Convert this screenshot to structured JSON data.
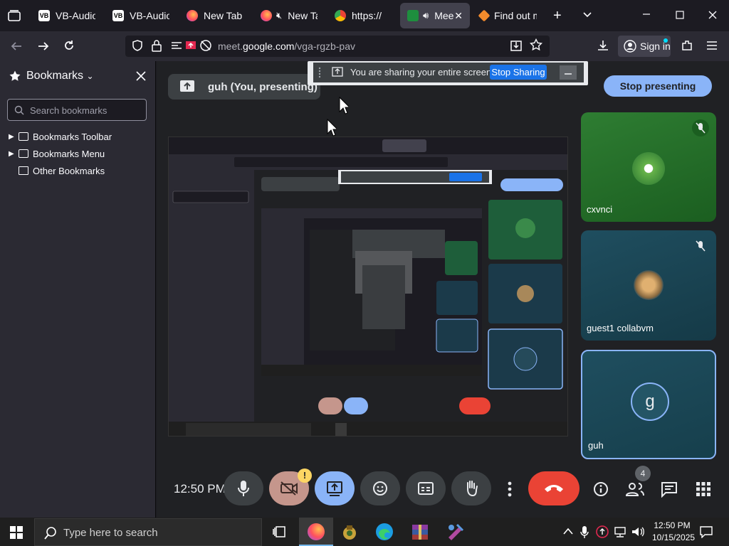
{
  "tabs": [
    {
      "title": "VB-Audio V",
      "icon": "vb-audio-icon"
    },
    {
      "title": "VB-Audio T",
      "icon": "vb-audio-icon"
    },
    {
      "title": "New Tab",
      "icon": "firefox-icon"
    },
    {
      "title": "New Ta",
      "icon": "firefox-icon"
    },
    {
      "title": "https://",
      "icon": "chrome-icon"
    },
    {
      "title": "Mee",
      "icon": "meet-icon"
    },
    {
      "title": "Find out m",
      "icon": "diamond-icon"
    }
  ],
  "address": {
    "prefix": "meet.",
    "domain": "google.com",
    "path": "/vga-rgzb-pav"
  },
  "sign_in": "Sign in",
  "sidebar": {
    "title": "Bookmarks",
    "search_placeholder": "Search bookmarks",
    "items": [
      {
        "label": "Bookmarks Toolbar"
      },
      {
        "label": "Bookmarks Menu"
      },
      {
        "label": "Other Bookmarks"
      }
    ]
  },
  "meet": {
    "presenting_label": "guh (You, presenting)",
    "sharing_text": "You are sharing your entire screen.",
    "stop_sharing": "Stop Sharing",
    "stop_presenting": "Stop presenting",
    "time": "12:50 PM",
    "notice_badge": "!",
    "people_count": "4",
    "participants": [
      {
        "name": "cxvnci",
        "muted": true
      },
      {
        "name": "guest1 collabvm",
        "muted": true
      },
      {
        "name": "guh",
        "initial": "g",
        "muted": false
      }
    ]
  },
  "taskbar": {
    "search_placeholder": "Type here to search",
    "time": "12:50 PM",
    "date": "10/15/2025"
  },
  "colors": {
    "accent": "#8ab4f8",
    "end_call": "#ea4335",
    "present": "#8ab4f8",
    "camera_off": "#c5968c"
  }
}
